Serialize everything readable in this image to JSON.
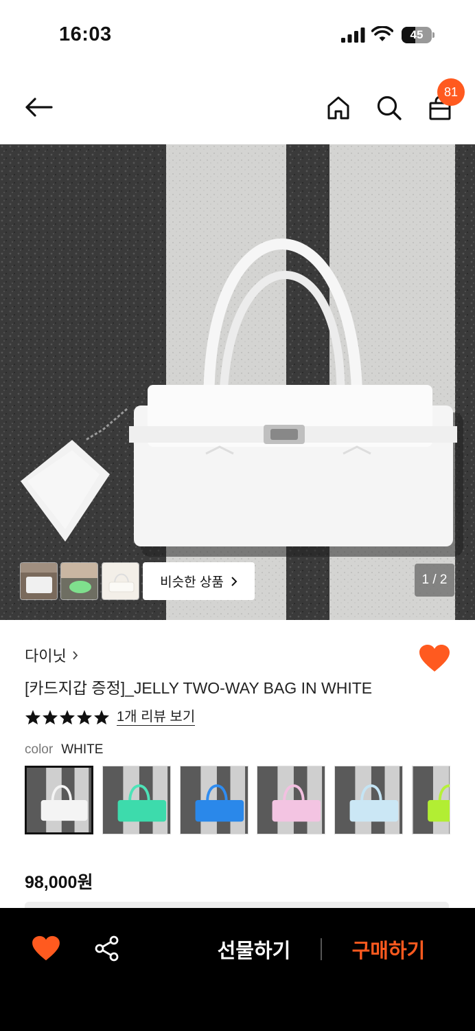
{
  "status_bar": {
    "time": "16:03",
    "battery_level": "45"
  },
  "nav": {
    "cart_count": "81"
  },
  "gallery": {
    "similar_label": "비슷한 상품",
    "page_indicator": "1 / 2"
  },
  "product": {
    "brand": "다이닛",
    "title": "[카드지갑 증정]_JELLY TWO-WAY BAG IN WHITE",
    "rating_stars": 5,
    "review_link": "1개 리뷰 보기",
    "option_key": "color",
    "option_value": "WHITE",
    "price": "98,000원",
    "swatch_colors": [
      "white",
      "mint",
      "blue",
      "pink",
      "light blue",
      "lime"
    ]
  },
  "bottom_bar": {
    "gift_label": "선물하기",
    "buy_label": "구매하기"
  },
  "colors": {
    "accent": "#ff5a1f",
    "bottom_bar_bg": "#000000"
  }
}
